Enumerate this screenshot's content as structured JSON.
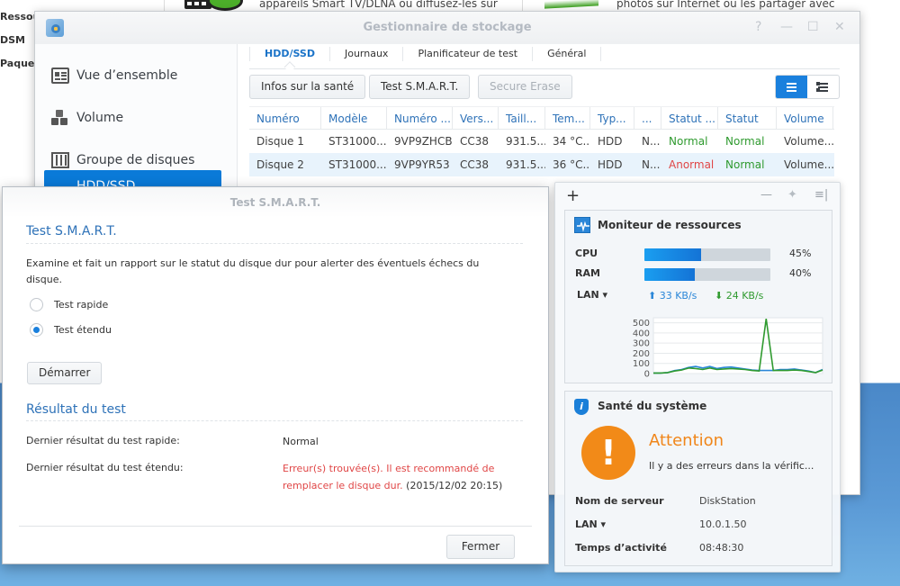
{
  "background": {
    "sidebar_items": [
      "Ressou",
      "DSM",
      "Paquet"
    ],
    "snippet_left": "appareils Smart TV/DLNA ou diffusez-les sur",
    "snippet_right": "photos sur Internet ou les partager avec"
  },
  "storage_window": {
    "title": "Gestionnaire de stockage",
    "controls": {
      "help": "?",
      "minimize": "—",
      "maximize": "☐",
      "close": "✕"
    },
    "sidebar": [
      {
        "label": "Vue d’ensemble",
        "icon": "overview-icon"
      },
      {
        "label": "Volume",
        "icon": "volume-icon"
      },
      {
        "label": "Groupe de disques",
        "icon": "disk-group-icon"
      },
      {
        "label": "HDD/SSD",
        "icon": "hdd-icon",
        "active": true
      }
    ],
    "tabs": [
      {
        "label": "HDD/SSD",
        "active": true
      },
      {
        "label": "Journaux"
      },
      {
        "label": "Planificateur de test"
      },
      {
        "label": "Général"
      }
    ],
    "toolbar": {
      "health_info": "Infos sur la santé",
      "smart_test": "Test S.M.A.R.T.",
      "secure_erase": "Secure Erase"
    },
    "table": {
      "headers": [
        "Numéro",
        "Modèle",
        "Numéro ...",
        "Vers...",
        "Taill...",
        "Tem...",
        "Typ...",
        "...",
        "Statut ...",
        "Statut",
        "Volume"
      ],
      "rows": [
        [
          "Disque 1",
          "ST31000...",
          "9VP9ZHCB",
          "CC38",
          "931.5...",
          "34 °C...",
          "HDD",
          "N...",
          "Normal",
          "Normal",
          "Volume..."
        ],
        [
          "Disque 2",
          "ST31000...",
          "9VP9YR53",
          "CC38",
          "931.5...",
          "36 °C...",
          "HDD",
          "N...",
          "Anormal",
          "Normal",
          "Volume..."
        ]
      ]
    }
  },
  "smart_dialog": {
    "title": "Test S.M.A.R.T.",
    "section_title": "Test S.M.A.R.T.",
    "description": "Examine et fait un rapport sur le statut du disque dur pour alerter des éventuels échecs du disque.",
    "options": [
      {
        "label": "Test rapide",
        "checked": false
      },
      {
        "label": "Test étendu",
        "checked": true
      }
    ],
    "start_button": "Démarrer",
    "results_title": "Résultat du test",
    "quick_label": "Dernier résultat du test rapide:",
    "quick_value": "Normal",
    "extended_label": "Dernier résultat du test étendu:",
    "extended_error": "Erreur(s) trouvée(s). Il est recommandé de remplacer le disque dur.",
    "extended_date": "(2015/12/02 20:15)",
    "close_button": "Fermer"
  },
  "widgets": {
    "add": "+",
    "controls": {
      "minimize": "—",
      "pin": "📌",
      "panel": "≡|"
    },
    "resource_monitor": {
      "title": "Moniteur de ressources",
      "cpu_label": "CPU",
      "cpu_percent": 45,
      "cpu_text": "45%",
      "ram_label": "RAM",
      "ram_percent": 40,
      "ram_text": "40%",
      "lan_label": "LAN ▾",
      "upload": "33 KB/s",
      "download": "24 KB/s",
      "colors": {
        "upload": "#2a86d8",
        "download": "#2f9a2f"
      }
    },
    "system_health": {
      "title": "Santé du système",
      "status": "Attention",
      "message": "Il y a des erreurs dans la vérific...",
      "server_name_label": "Nom de serveur",
      "server_name": "DiskStation",
      "lan_label": "LAN ▾",
      "lan_ip": "10.0.1.50",
      "uptime_label": "Temps d’activité",
      "uptime": "08:48:30"
    }
  },
  "chart_data": {
    "type": "line",
    "title": "",
    "xlabel": "",
    "ylabel": "",
    "ylim": [
      0,
      550
    ],
    "yticks": [
      0,
      100,
      200,
      300,
      400,
      500
    ],
    "grid": true,
    "legend": "none",
    "series": [
      {
        "name": "upload",
        "color": "#2a86d8",
        "values": [
          5,
          5,
          10,
          30,
          40,
          60,
          70,
          55,
          70,
          50,
          60,
          65,
          55,
          45,
          35,
          30,
          30,
          30,
          40,
          40,
          45,
          35,
          25,
          10,
          40
        ]
      },
      {
        "name": "download",
        "color": "#2f9a2f",
        "values": [
          5,
          5,
          10,
          25,
          35,
          55,
          50,
          40,
          55,
          40,
          45,
          50,
          45,
          40,
          30,
          25,
          540,
          30,
          30,
          30,
          35,
          30,
          20,
          10,
          35
        ]
      }
    ]
  }
}
